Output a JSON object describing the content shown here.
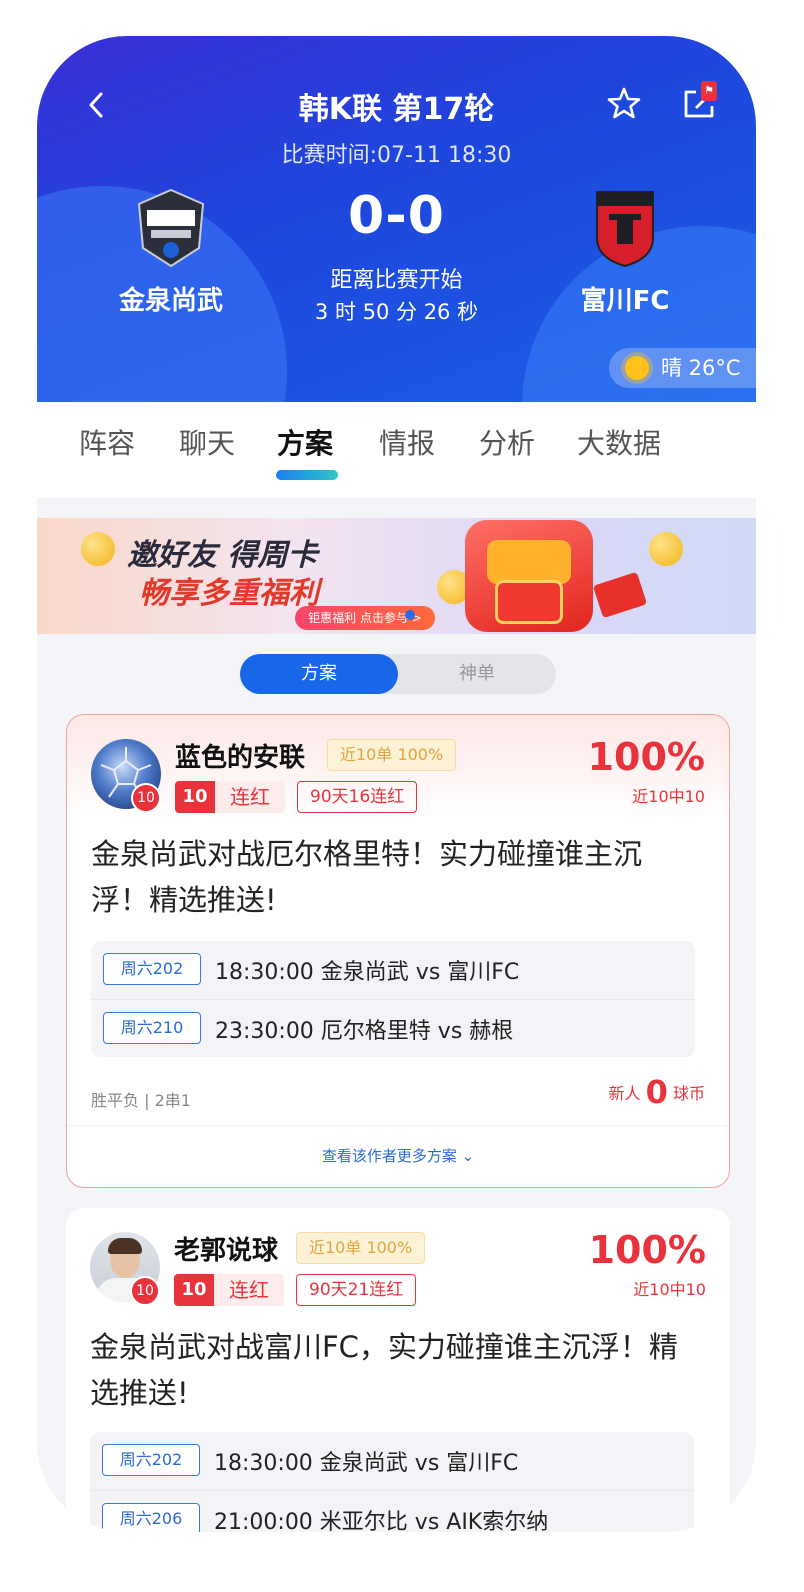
{
  "header": {
    "title": "韩K联 第17轮",
    "match_time": "比赛时间:07-11 18:30",
    "home_team": "金泉尚武",
    "away_team": "富川FC",
    "score": "0-0",
    "countdown_label": "距离比赛开始",
    "countdown": "3 时 50 分 26 秒",
    "weather": "晴 26°C",
    "share_tag": "⚑"
  },
  "tabs": [
    "阵容",
    "聊天",
    "方案",
    "情报",
    "分析",
    "大数据"
  ],
  "active_tab": "方案",
  "banner": {
    "line1": "邀好友 得周卡",
    "line2": "畅享多重福利",
    "cta": "钜惠福利 点击参与 >"
  },
  "segment": {
    "active": "方案",
    "inactive": "神单"
  },
  "cards": [
    {
      "username": "蓝色的安联",
      "avatar_badge": "10",
      "rate_tag": "近10单 100%",
      "streak_num": "10",
      "streak_label": "连红",
      "streak_90": "90天16连红",
      "percent": "100%",
      "percent_sub": "近10中10",
      "description": "金泉尚武对战厄尔格里特！实力碰撞谁主沉浮！精选推送!",
      "matches": [
        {
          "tag": "周六202",
          "text": "18:30:00 金泉尚武 vs 富川FC"
        },
        {
          "tag": "周六210",
          "text": "23:30:00 厄尔格里特 vs 赫根"
        }
      ],
      "play_type": "胜平负 | 2串1",
      "price_prefix": "新人",
      "price_value": "0",
      "price_unit": "球币",
      "more": "查看该作者更多方案 ⌄"
    },
    {
      "username": "老郭说球",
      "avatar_badge": "10",
      "rate_tag": "近10单 100%",
      "streak_num": "10",
      "streak_label": "连红",
      "streak_90": "90天21连红",
      "percent": "100%",
      "percent_sub": "近10中10",
      "description": "金泉尚武对战富川FC，实力碰撞谁主沉浮！精选推送!",
      "matches": [
        {
          "tag": "周六202",
          "text": "18:30:00 金泉尚武 vs 富川FC"
        },
        {
          "tag": "周六206",
          "text": "21:00:00 米亚尔比 vs AIK索尔纳"
        }
      ]
    }
  ]
}
